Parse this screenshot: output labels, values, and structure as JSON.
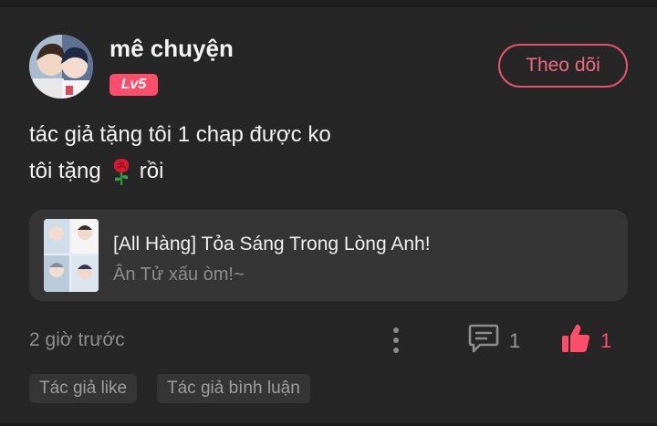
{
  "comment": {
    "user": {
      "name": "mê chuyện",
      "level": "Lv5",
      "follow_label": "Theo dõi"
    },
    "text_line1": "tác giả tặng tôi 1 chap được ko",
    "text_line2_before": "tôi tặng",
    "text_line2_icon": "rose-icon",
    "text_line2_after": "rồi",
    "book": {
      "title": "[All Hàng] Tỏa Sáng Trong Lòng Anh!",
      "author": "Ân Tử xấu òm!~"
    },
    "timestamp": "2 giờ trước",
    "reply_count": "1",
    "like_count": "1",
    "tags": [
      "Tác giả like",
      "Tác giả bình luận"
    ]
  },
  "colors": {
    "background": "#262626",
    "accent": "#ff4d6a",
    "card": "#353535",
    "muted_text": "#8e8e8e"
  },
  "icons": [
    "avatar",
    "rose-icon",
    "book-cover",
    "more-options-icon",
    "comment-icon",
    "thumbs-up-icon"
  ]
}
